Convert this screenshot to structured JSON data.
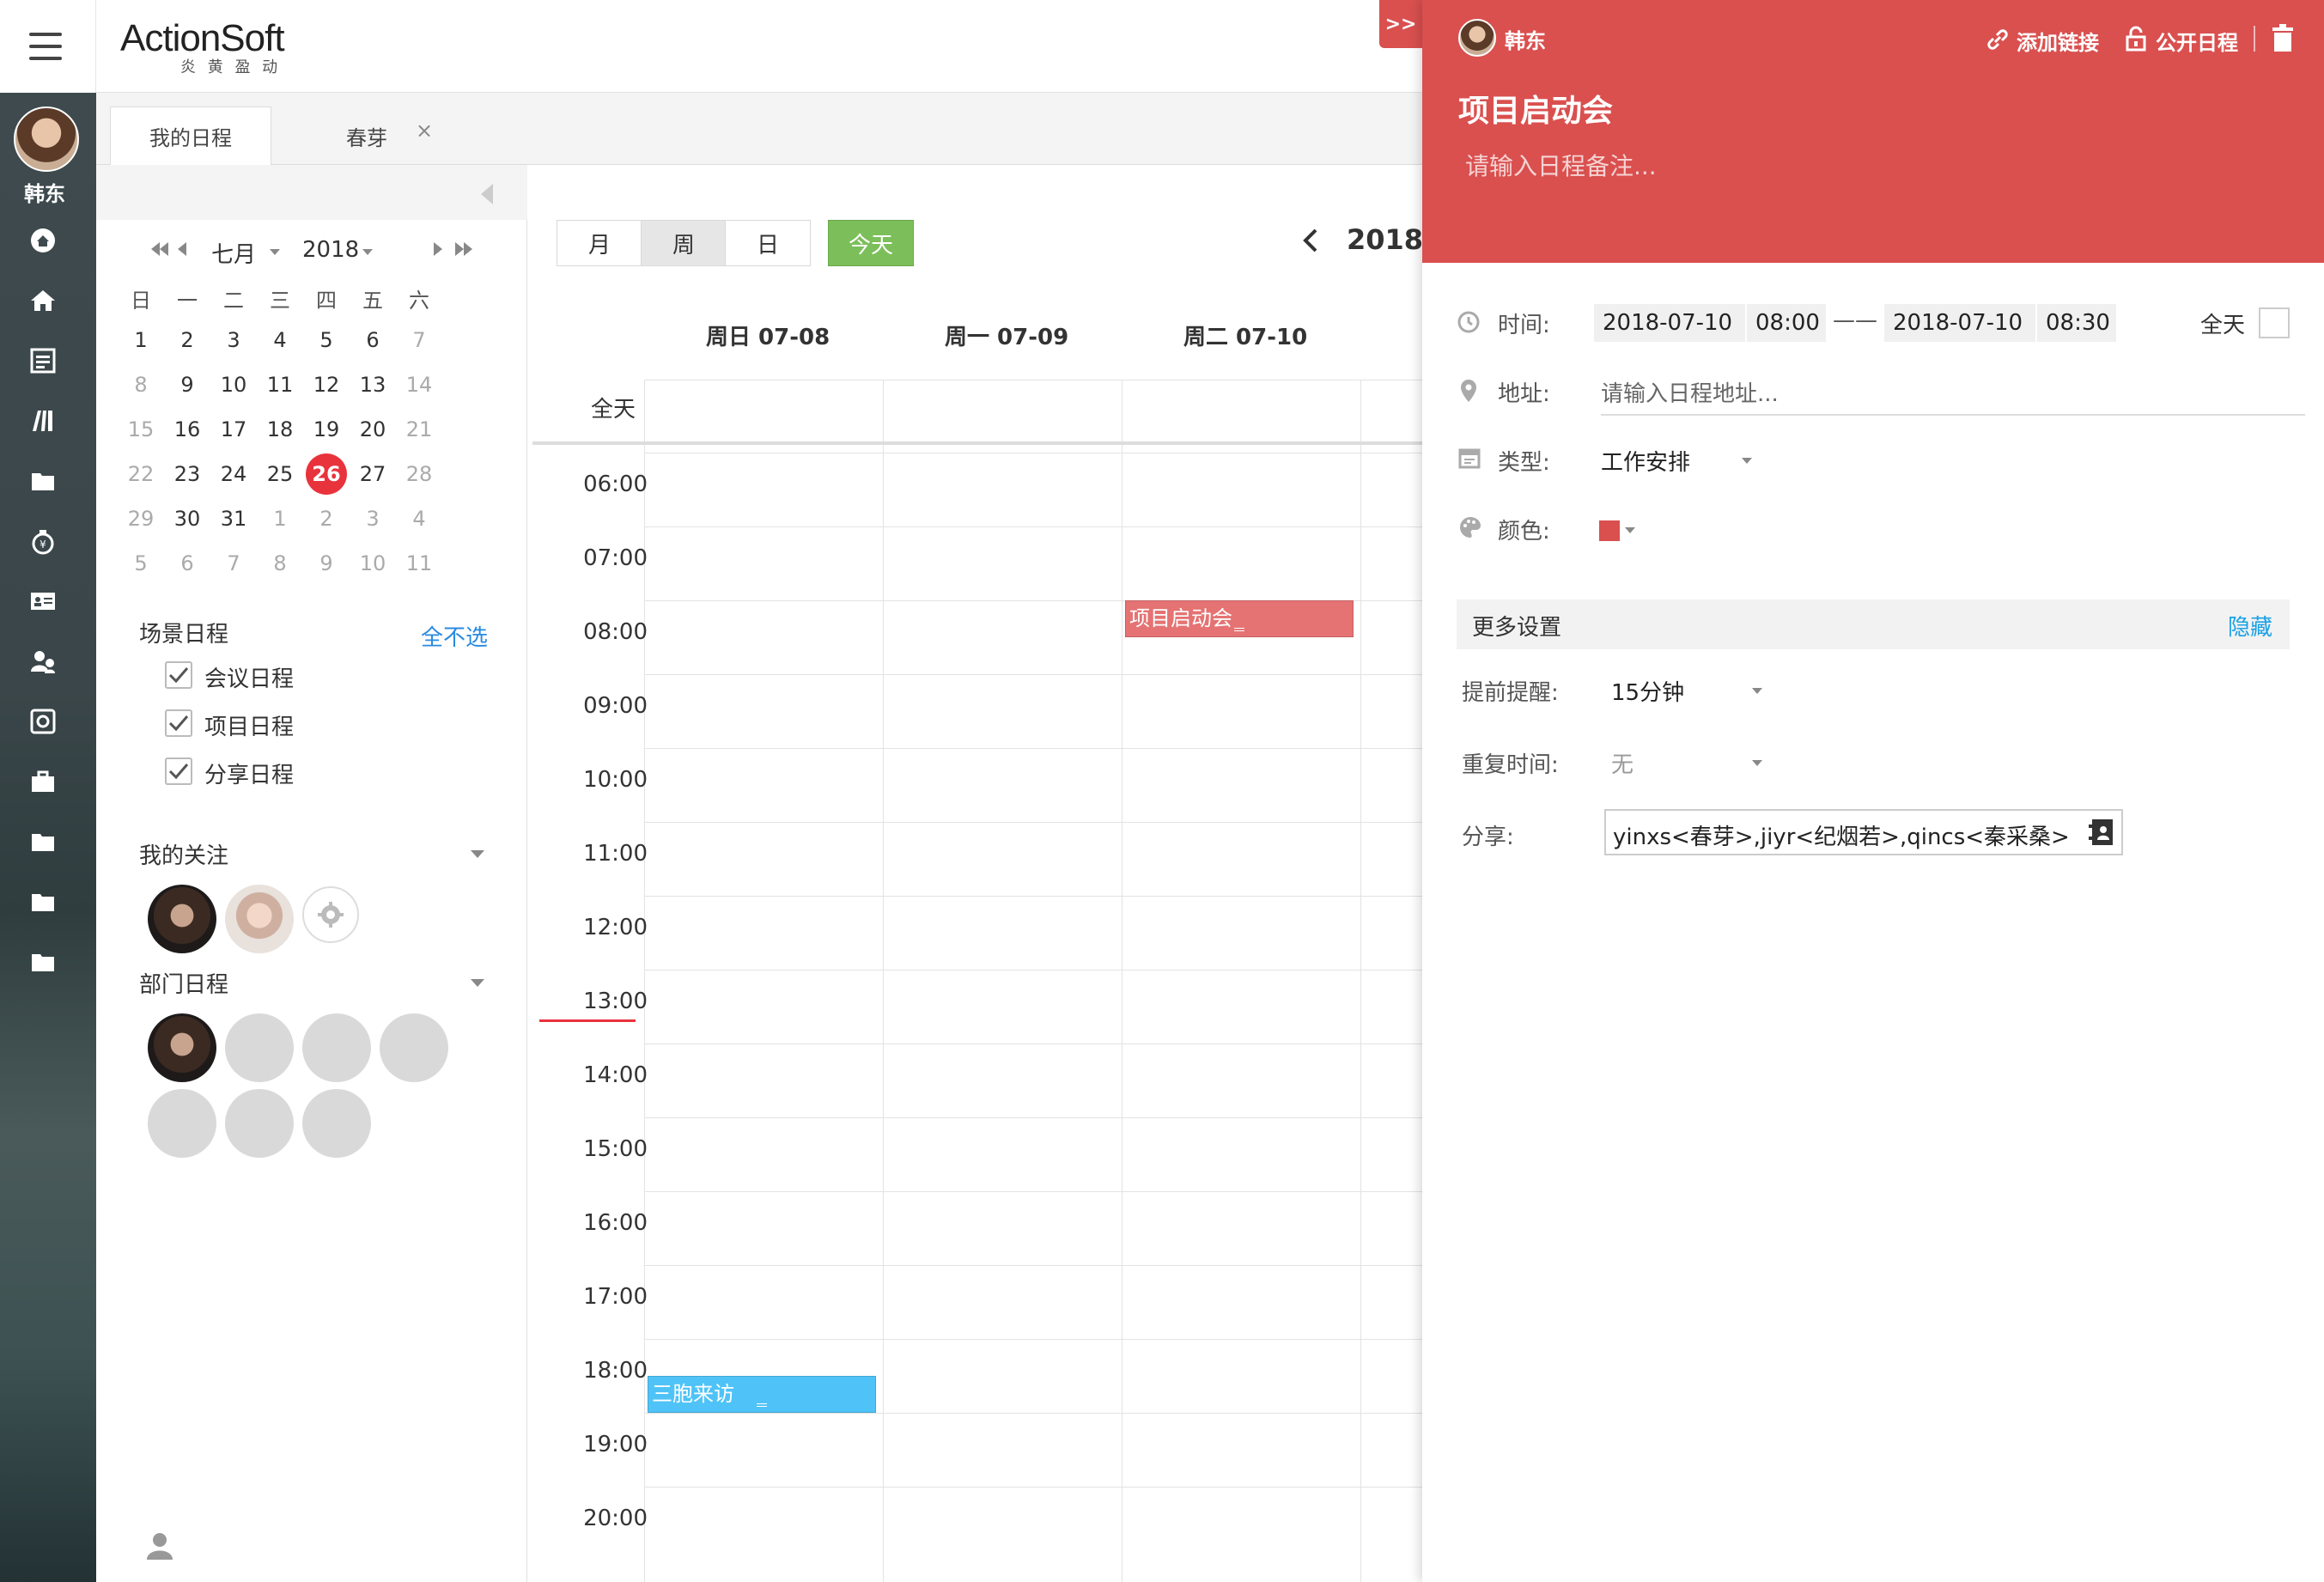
{
  "app": {
    "logo_main": "ActionSoft",
    "logo_sub": "炎 黄 盈 动",
    "user_name": "韩东"
  },
  "tabs": [
    {
      "label": "我的日程",
      "active": true
    },
    {
      "label": "春芽",
      "active": false
    }
  ],
  "mini_calendar": {
    "month": "七月",
    "year": "2018",
    "weekdays": [
      "日",
      "一",
      "二",
      "三",
      "四",
      "五",
      "六"
    ],
    "weeks": [
      [
        {
          "d": "1"
        },
        {
          "d": "2"
        },
        {
          "d": "3"
        },
        {
          "d": "4"
        },
        {
          "d": "5"
        },
        {
          "d": "6"
        },
        {
          "d": "7",
          "m": true
        }
      ],
      [
        {
          "d": "8",
          "m": true
        },
        {
          "d": "9"
        },
        {
          "d": "10"
        },
        {
          "d": "11"
        },
        {
          "d": "12"
        },
        {
          "d": "13"
        },
        {
          "d": "14",
          "m": true
        }
      ],
      [
        {
          "d": "15",
          "m": true
        },
        {
          "d": "16"
        },
        {
          "d": "17"
        },
        {
          "d": "18"
        },
        {
          "d": "19"
        },
        {
          "d": "20"
        },
        {
          "d": "21",
          "m": true
        }
      ],
      [
        {
          "d": "22",
          "m": true
        },
        {
          "d": "23"
        },
        {
          "d": "24"
        },
        {
          "d": "25"
        },
        {
          "d": "26",
          "today": true
        },
        {
          "d": "27"
        },
        {
          "d": "28",
          "m": true
        }
      ],
      [
        {
          "d": "29",
          "m": true
        },
        {
          "d": "30"
        },
        {
          "d": "31"
        },
        {
          "d": "1",
          "o": true
        },
        {
          "d": "2",
          "o": true
        },
        {
          "d": "3",
          "o": true
        },
        {
          "d": "4",
          "o": true
        }
      ],
      [
        {
          "d": "5",
          "o": true
        },
        {
          "d": "6",
          "o": true
        },
        {
          "d": "7",
          "o": true
        },
        {
          "d": "8",
          "o": true
        },
        {
          "d": "9",
          "o": true
        },
        {
          "d": "10",
          "o": true
        },
        {
          "d": "11",
          "o": true
        }
      ]
    ]
  },
  "scenes": {
    "title": "场景日程",
    "deselect_all": "全不选",
    "items": [
      {
        "label": "会议日程",
        "checked": true
      },
      {
        "label": "项目日程",
        "checked": true
      },
      {
        "label": "分享日程",
        "checked": true
      }
    ]
  },
  "follows": {
    "title": "我的关注"
  },
  "dept": {
    "title": "部门日程"
  },
  "calendar": {
    "views": [
      "月",
      "周",
      "日"
    ],
    "active_view": "周",
    "today_label": "今天",
    "range_title": "2018",
    "all_day_label": "全天",
    "days": [
      "周日 07-08",
      "周一 07-09",
      "周二 07-10"
    ],
    "hours": [
      "06:00",
      "07:00",
      "08:00",
      "09:00",
      "10:00",
      "11:00",
      "12:00",
      "13:00",
      "14:00",
      "15:00",
      "16:00",
      "17:00",
      "18:00",
      "19:00",
      "20:00"
    ],
    "events": [
      {
        "title": "项目启动会",
        "day": 2,
        "start": "08:00",
        "end": "08:30",
        "color": "#e57373"
      },
      {
        "title": "三胞来访",
        "day": 0,
        "start": "18:30",
        "end": "19:00",
        "color": "#4fc3f7"
      }
    ],
    "accent_red": "#e8333c"
  },
  "detail": {
    "collapse_label": ">>",
    "owner": "韩东",
    "add_link": "添加链接",
    "public": "公开日程",
    "title": "项目启动会",
    "note_placeholder": "请输入日程备注...",
    "header_color": "#d9504f",
    "time_label": "时间:",
    "start_date": "2018-07-10",
    "start_time": "08:00",
    "separator": "——",
    "end_date": "2018-07-10",
    "end_time": "08:30",
    "allday_label": "全天",
    "address_label": "地址:",
    "address_placeholder": "请输入日程地址...",
    "type_label": "类型:",
    "type_value": "工作安排",
    "color_label": "颜色:",
    "color_value": "#d9504f",
    "more_settings": "更多设置",
    "hide": "隐藏",
    "remind_label": "提前提醒:",
    "remind_value": "15分钟",
    "repeat_label": "重复时间:",
    "repeat_value": "无",
    "share_label": "分享:",
    "share_value": "yinxs<春芽>,jiyr<纪烟若>,qincs<秦采桑>,yinq<"
  }
}
